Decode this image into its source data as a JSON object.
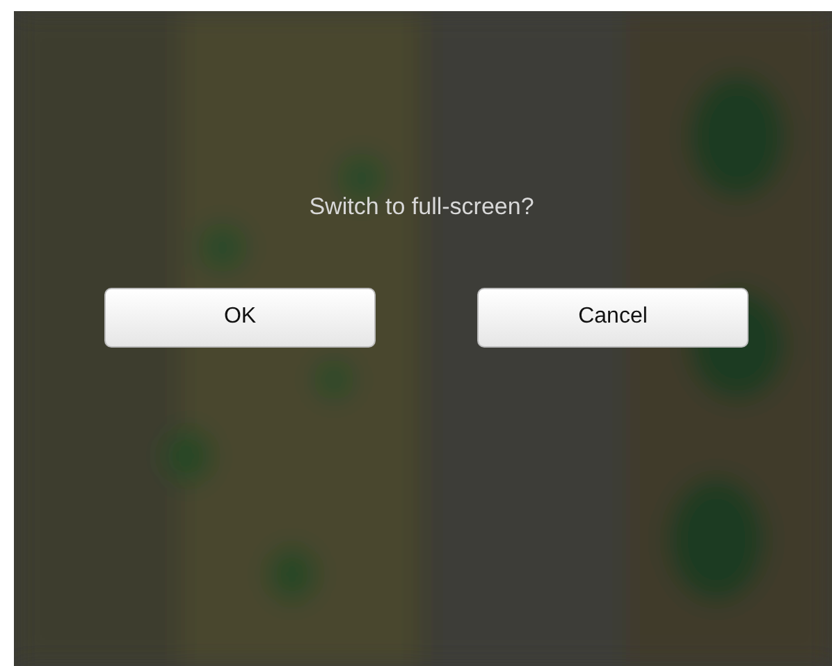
{
  "dialog": {
    "message": "Switch to full-screen?",
    "buttons": [
      {
        "label": "OK"
      },
      {
        "label": "Cancel"
      }
    ]
  }
}
